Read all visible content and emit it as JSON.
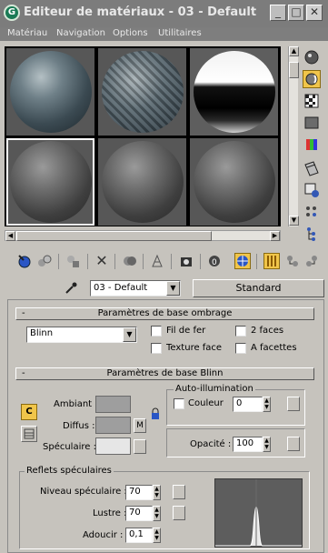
{
  "window": {
    "title": "Editeur de matériaux - 03 - Default",
    "app_icon": "3ds-max-icon",
    "controls": {
      "minimize": "_",
      "maximize": "□",
      "close": "✕"
    }
  },
  "menubar": {
    "items": [
      "Matériau",
      "Navigation",
      "Options",
      "Utilitaires"
    ]
  },
  "slots": [
    {
      "type": "stone"
    },
    {
      "type": "metal"
    },
    {
      "type": "chrome"
    },
    {
      "type": "default"
    },
    {
      "type": "default"
    },
    {
      "type": "default"
    }
  ],
  "side_tools": [
    "sample-type-icon",
    "backlight-icon",
    "background-checker-icon",
    "sample-uv-tiling-icon",
    "video-color-check-icon",
    "make-preview-icon",
    "options-icon",
    "select-by-material-icon",
    "material-map-navigator-icon"
  ],
  "toolbar": {
    "icons": [
      "get-material-icon",
      "put-to-scene-icon",
      "assign-to-selection-icon",
      "reset-icon",
      "make-copy-icon",
      "make-unique-icon",
      "put-to-library-icon",
      "material-id-icon",
      "show-map-icon",
      "show-end-result-icon",
      "go-to-parent-icon",
      "go-forward-icon"
    ]
  },
  "selector": {
    "material_name": "03 - Default",
    "type_button": "Standard"
  },
  "shader_rollout": {
    "title": "Paramètres de base ombrage",
    "collapse": "-",
    "shader": "Blinn",
    "options": [
      {
        "label": "Fil de fer",
        "checked": false
      },
      {
        "label": "2 faces",
        "checked": false
      },
      {
        "label": "Texture face",
        "checked": false
      },
      {
        "label": "A facettes",
        "checked": false
      }
    ]
  },
  "blinn_rollout": {
    "title": "Paramètres de base Blinn",
    "collapse": "-",
    "lock_label": "C",
    "colors": [
      {
        "label": "Ambiant :",
        "color": "#9e9e9e"
      },
      {
        "label": "Diffus :",
        "color": "#9e9e9e",
        "map_label": "M"
      },
      {
        "label": "Spéculaire :",
        "color": "#e6e6e6"
      }
    ],
    "self_illum": {
      "title": "Auto-illumination",
      "color_label": "Couleur",
      "value": "0"
    },
    "opacity": {
      "label": "Opacité :",
      "value": "100"
    },
    "highlights": {
      "title": "Reflets spéculaires",
      "level_label": "Niveau spéculaire :",
      "level": "70",
      "gloss_label": "Lustre :",
      "gloss": "70",
      "soften_label": "Adoucir :",
      "soften": "0,1"
    }
  }
}
